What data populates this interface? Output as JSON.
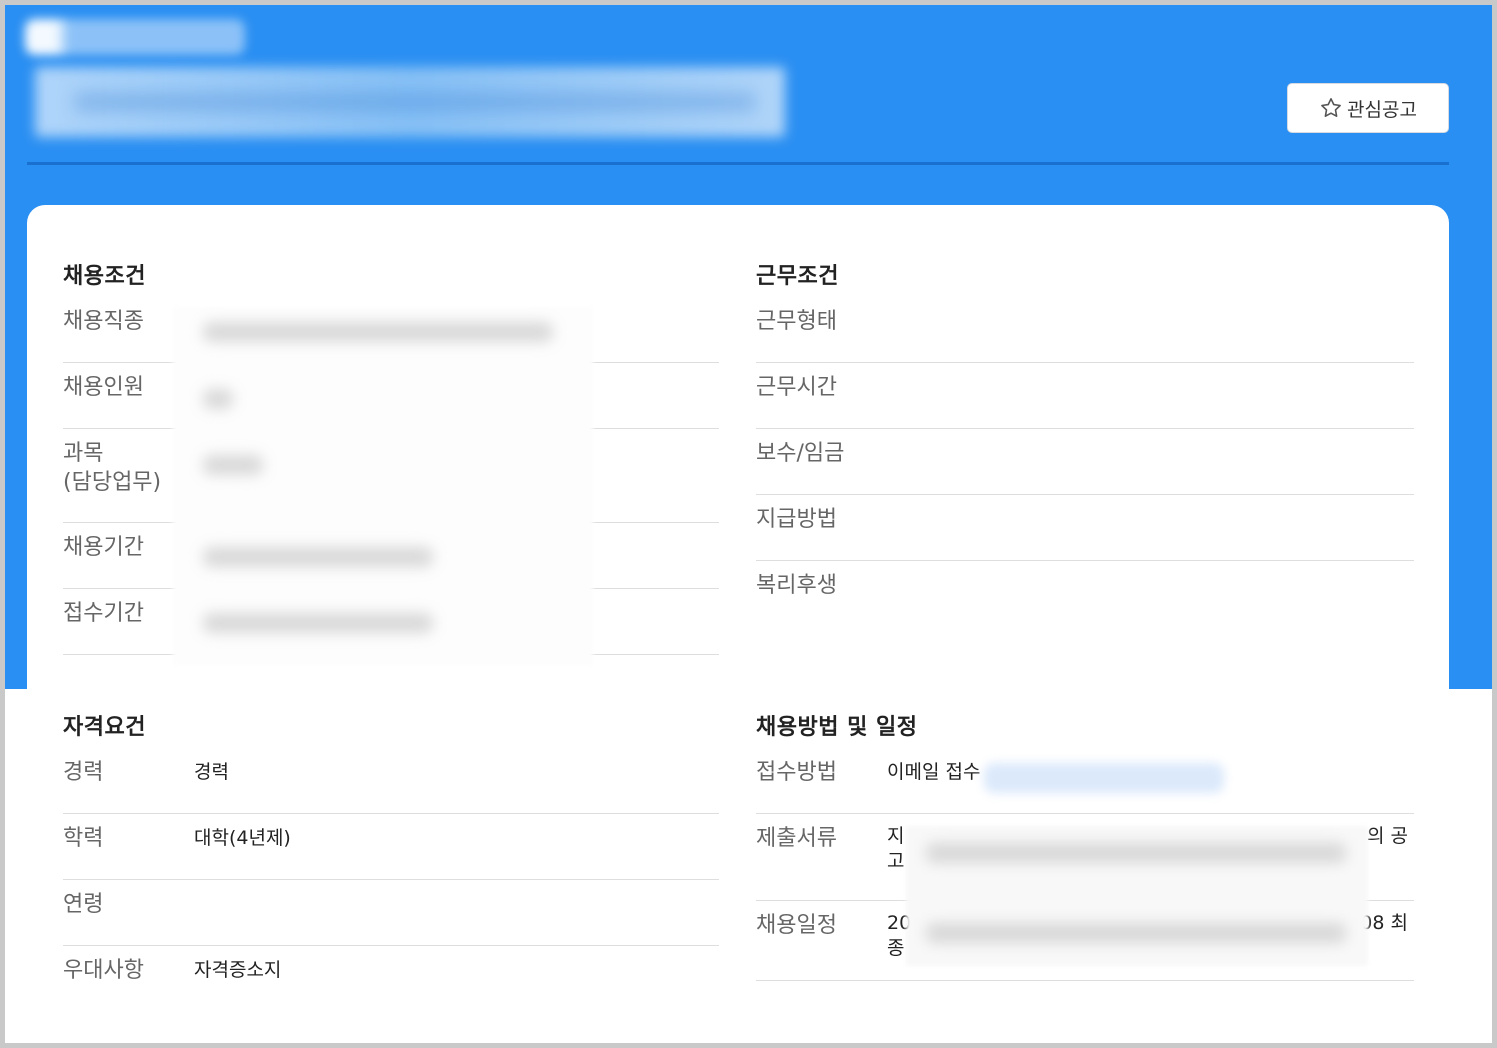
{
  "header": {
    "favorite_label": "관심공고",
    "accent_color": "#2a8ff2"
  },
  "recruit_conditions": {
    "title": "채용조건",
    "rows": [
      {
        "label": "채용직종",
        "value": ""
      },
      {
        "label": "채용인원",
        "value": ""
      },
      {
        "label": "과목\n(담당업무)",
        "value": ""
      },
      {
        "label": "채용기간",
        "value": ""
      },
      {
        "label": "접수기간",
        "value": ""
      }
    ]
  },
  "work_conditions": {
    "title": "근무조건",
    "rows": [
      {
        "label": "근무형태",
        "value": ""
      },
      {
        "label": "근무시간",
        "value": ""
      },
      {
        "label": "보수/임금",
        "value": ""
      },
      {
        "label": "지급방법",
        "value": ""
      },
      {
        "label": "복리후생",
        "value": ""
      }
    ]
  },
  "qualifications": {
    "title": "자격요건",
    "rows": [
      {
        "label": "경력",
        "value": "경력"
      },
      {
        "label": "학력",
        "value": "대학(4년제)"
      },
      {
        "label": "연령",
        "value": ""
      },
      {
        "label": "우대사항",
        "value": "자격증소지"
      }
    ]
  },
  "method_schedule": {
    "title": "채용방법 및 일정",
    "rows": [
      {
        "label": "접수방법",
        "value": "이메일 접수"
      },
      {
        "label": "제출서류",
        "value_start": "지",
        "value_end": "의 공",
        "value_line2": "고"
      },
      {
        "label": "채용일정",
        "value_start": "20",
        "value_end": "08 최",
        "value_line2": "종"
      }
    ]
  }
}
